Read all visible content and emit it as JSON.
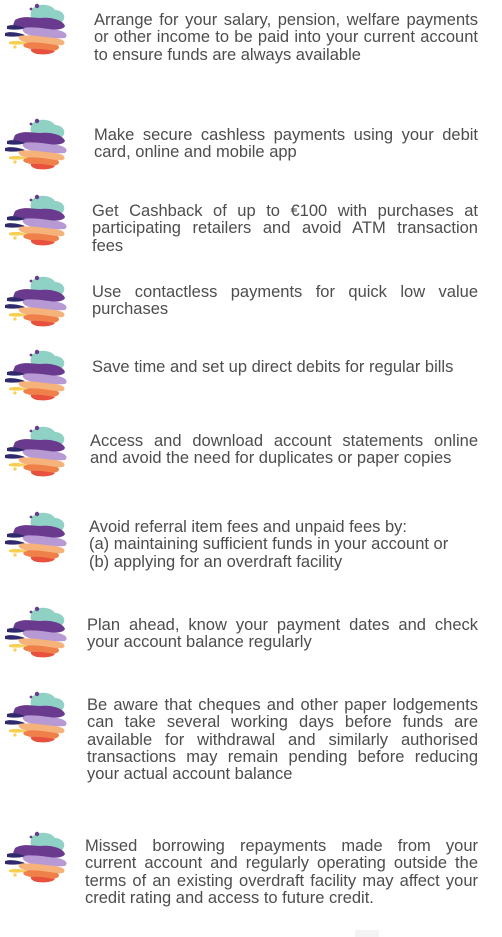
{
  "tips": [
    {
      "text": "Arrange for your salary, pension, welfare payments or other income to be paid into your current account to ensure funds are always available"
    },
    {
      "text": "Make secure cashless payments using your debit card, online and mobile app"
    },
    {
      "text": "Get Cashback of up to €100 with purchases at participating retailers and avoid ATM transaction fees"
    },
    {
      "text": "Use contactless payments for quick low value purchases"
    },
    {
      "text": "Save time and set up direct debits for regular bills"
    },
    {
      "text": "Access and download account statements online and avoid the need for duplicates or paper copies"
    },
    {
      "text": "Avoid referral item fees and unpaid fees by:\n(a) maintaining sufficient funds in your account or\n(b) applying for an overdraft facility"
    },
    {
      "text": "Plan ahead, know your payment dates and check your account balance regularly"
    },
    {
      "text": "Be aware that cheques and other paper lodgements can take several working days before funds are available for withdrawal and similarly authorised transactions may remain pending before reducing your actual account balance"
    },
    {
      "text": "Missed borrowing repayments made from your current account and regularly operating outside the terms of an existing overdraft facility may affect your credit rating and access to future credit."
    }
  ],
  "colors": {
    "text": "#4d4d4d",
    "teal": "#8fd1c4",
    "purple": "#6a3a8e",
    "lilac": "#b79ad3",
    "peach": "#f5b27a",
    "orange": "#f0804a",
    "red": "#e8513e",
    "yellow": "#f7cf55",
    "navy": "#2f2a6b"
  }
}
